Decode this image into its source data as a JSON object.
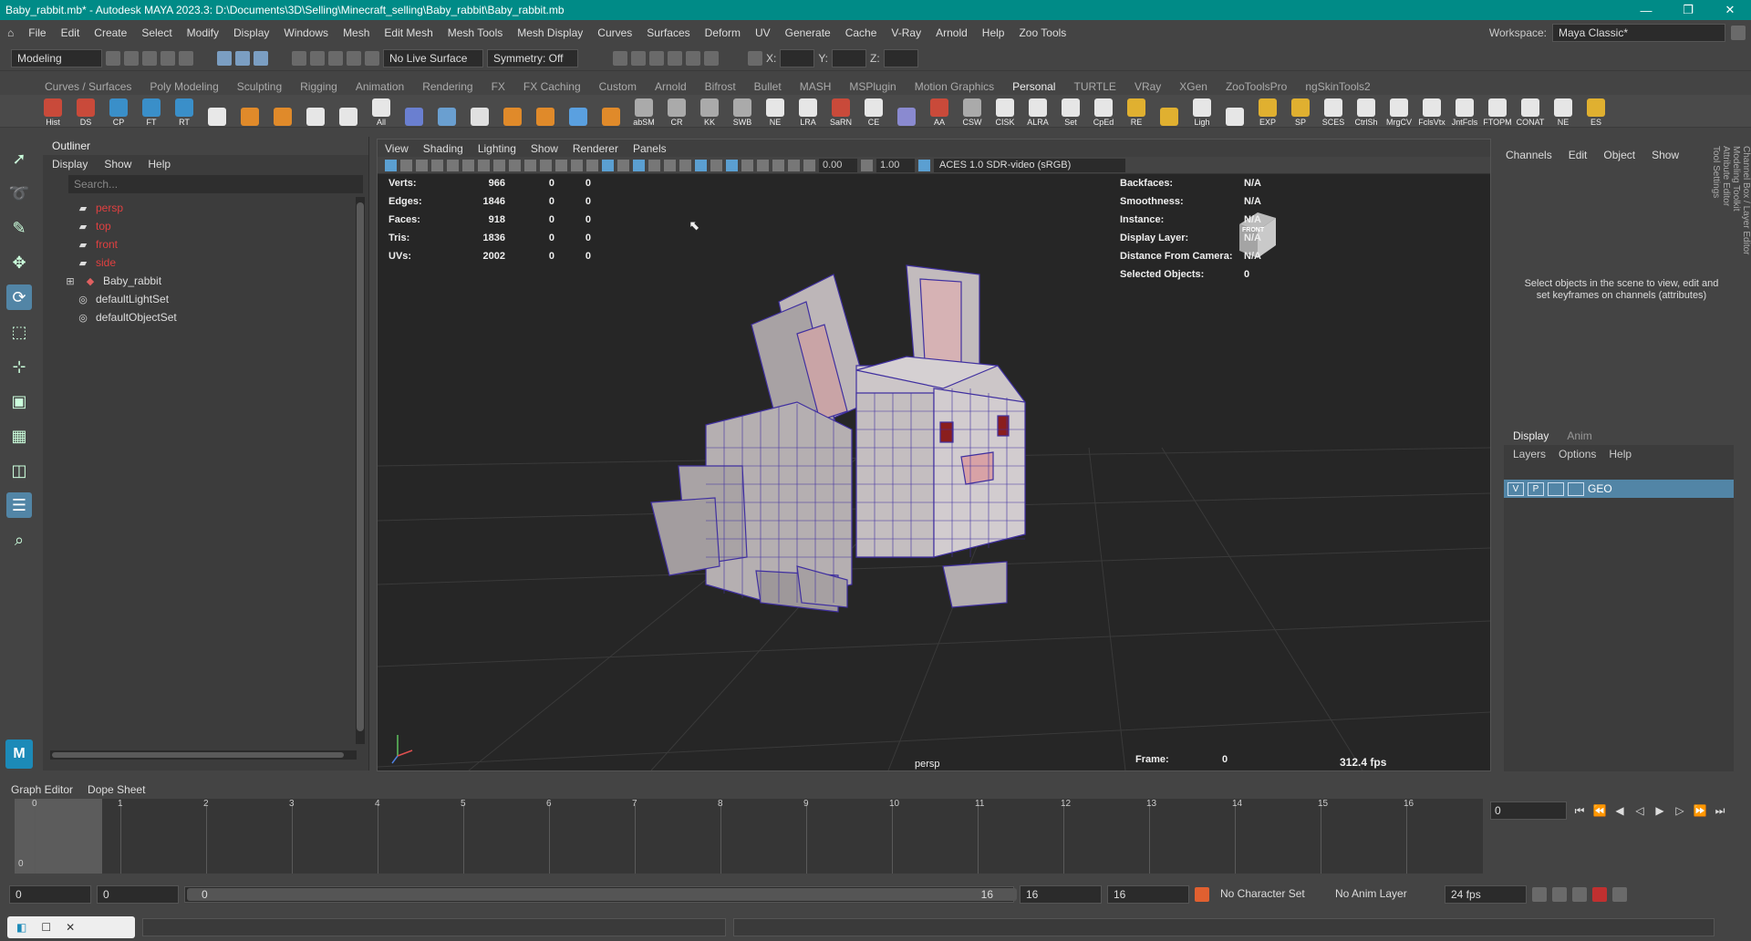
{
  "window": {
    "title": "Baby_rabbit.mb* - Autodesk MAYA 2023.3: D:\\Documents\\3D\\Selling\\Minecraft_selling\\Baby_rabbit\\Baby_rabbit.mb",
    "minimize": "—",
    "maximize": "❐",
    "close": "✕"
  },
  "menu": [
    "File",
    "Edit",
    "Create",
    "Select",
    "Modify",
    "Display",
    "Windows",
    "Mesh",
    "Edit Mesh",
    "Mesh Tools",
    "Mesh Display",
    "Curves",
    "Surfaces",
    "Deform",
    "UV",
    "Generate",
    "Cache",
    "V-Ray",
    "Arnold",
    "Help",
    "Zoo Tools"
  ],
  "workspace": {
    "label": "Workspace:",
    "value": "Maya Classic*"
  },
  "status": {
    "mode": "Modeling",
    "live": "No Live Surface",
    "symmetry": "Symmetry: Off",
    "x": "X:",
    "y": "Y:",
    "z": "Z:"
  },
  "shelf_tabs": [
    "Curves / Surfaces",
    "Poly Modeling",
    "Sculpting",
    "Rigging",
    "Animation",
    "Rendering",
    "FX",
    "FX Caching",
    "Custom",
    "Arnold",
    "Bifrost",
    "Bullet",
    "MASH",
    "MSPlugin",
    "Motion Graphics",
    "Personal",
    "TURTLE",
    "VRay",
    "XGen",
    "ZooToolsPro",
    "ngSkinTools2"
  ],
  "shelf_active": "Personal",
  "shelf_buttons": [
    {
      "label": "Hist",
      "color": "#c94a3a"
    },
    {
      "label": "DS",
      "color": "#c94a3a"
    },
    {
      "label": "CP",
      "color": "#3a8fc9"
    },
    {
      "label": "FT",
      "color": "#3a8fc9"
    },
    {
      "label": "RT",
      "color": "#3a8fc9"
    },
    {
      "label": "",
      "color": "#e8e8e8"
    },
    {
      "label": "",
      "color": "#e08a2a"
    },
    {
      "label": "",
      "color": "#e08a2a"
    },
    {
      "label": "",
      "color": "#e6e6e6"
    },
    {
      "label": "",
      "color": "#e6e6e6"
    },
    {
      "label": "All",
      "color": "#e6e6e6"
    },
    {
      "label": "",
      "color": "#6a7fd0"
    },
    {
      "label": "",
      "color": "#6a9fd0"
    },
    {
      "label": "",
      "color": "#e0e0e0"
    },
    {
      "label": "",
      "color": "#e08a2a"
    },
    {
      "label": "",
      "color": "#e08a2a"
    },
    {
      "label": "",
      "color": "#5aa0e0"
    },
    {
      "label": "",
      "color": "#e08a2a"
    },
    {
      "label": "abSM",
      "color": "#aaa"
    },
    {
      "label": "CR",
      "color": "#aaa"
    },
    {
      "label": "KK",
      "color": "#aaa"
    },
    {
      "label": "SWB",
      "color": "#aaa"
    },
    {
      "label": "NE",
      "color": "#e6e6e6"
    },
    {
      "label": "LRA",
      "color": "#e6e6e6"
    },
    {
      "label": "SaRN",
      "color": "#c94a3a"
    },
    {
      "label": "CE",
      "color": "#e6e6e6"
    },
    {
      "label": "",
      "color": "#8a8ad0"
    },
    {
      "label": "AA",
      "color": "#c94a3a"
    },
    {
      "label": "CSW",
      "color": "#aaa"
    },
    {
      "label": "CISK",
      "color": "#e6e6e6"
    },
    {
      "label": "ALRA",
      "color": "#e6e6e6"
    },
    {
      "label": "Set",
      "color": "#e6e6e6"
    },
    {
      "label": "CpEd",
      "color": "#e6e6e6"
    },
    {
      "label": "RE",
      "color": "#e0b030"
    },
    {
      "label": "",
      "color": "#e0b030"
    },
    {
      "label": "Ligh",
      "color": "#e6e6e6"
    },
    {
      "label": "",
      "color": "#e6e6e6"
    },
    {
      "label": "EXP",
      "color": "#e0b030"
    },
    {
      "label": "SP",
      "color": "#e0b030"
    },
    {
      "label": "SCES",
      "color": "#e6e6e6"
    },
    {
      "label": "CtrlSh",
      "color": "#e6e6e6"
    },
    {
      "label": "MrgCV",
      "color": "#e6e6e6"
    },
    {
      "label": "FclsVtx",
      "color": "#e6e6e6"
    },
    {
      "label": "JntFcls",
      "color": "#e6e6e6"
    },
    {
      "label": "FTOPM",
      "color": "#e6e6e6"
    },
    {
      "label": "CONAT",
      "color": "#e6e6e6"
    },
    {
      "label": "NE",
      "color": "#e6e6e6"
    },
    {
      "label": "ES",
      "color": "#e0b030"
    }
  ],
  "outliner": {
    "title": "Outliner",
    "menu": [
      "Display",
      "Show",
      "Help"
    ],
    "search_placeholder": "Search...",
    "items": [
      {
        "name": "persp",
        "kind": "camera"
      },
      {
        "name": "top",
        "kind": "camera"
      },
      {
        "name": "front",
        "kind": "camera"
      },
      {
        "name": "side",
        "kind": "camera"
      },
      {
        "name": "Baby_rabbit",
        "kind": "mesh"
      },
      {
        "name": "defaultLightSet",
        "kind": "set"
      },
      {
        "name": "defaultObjectSet",
        "kind": "set"
      }
    ]
  },
  "viewport": {
    "menu": [
      "View",
      "Shading",
      "Lighting",
      "Show",
      "Renderer",
      "Panels"
    ],
    "exposure": "0.00",
    "gamma": "1.00",
    "colorspace": "ACES 1.0 SDR-video (sRGB)",
    "camera": "persp",
    "fps": "312.4 fps",
    "hud_left": [
      [
        "Verts:",
        "966",
        "0",
        "0"
      ],
      [
        "Edges:",
        "1846",
        "0",
        "0"
      ],
      [
        "Faces:",
        "918",
        "0",
        "0"
      ],
      [
        "Tris:",
        "1836",
        "0",
        "0"
      ],
      [
        "UVs:",
        "2002",
        "0",
        "0"
      ]
    ],
    "hud_right": [
      [
        "Backfaces:",
        "N/A"
      ],
      [
        "Smoothness:",
        "N/A"
      ],
      [
        "Instance:",
        "N/A"
      ],
      [
        "Display Layer:",
        "N/A"
      ],
      [
        "Distance From Camera:",
        "N/A"
      ],
      [
        "Selected Objects:",
        "0"
      ]
    ],
    "frame_label": "Frame:",
    "frame_value": "0",
    "viewcube": "FRONT"
  },
  "channelbox": {
    "tabs": [
      "Channels",
      "Edit",
      "Object",
      "Show"
    ],
    "message": "Select objects in the scene to view, edit and set keyframes on channels (attributes)"
  },
  "layers": {
    "tabs": [
      "Display",
      "Anim"
    ],
    "menu": [
      "Layers",
      "Options",
      "Help"
    ],
    "row": {
      "v": "V",
      "p": "P",
      "name": "GEO"
    }
  },
  "side_tabs": [
    "Channel Box / Layer Editor",
    "Modeling Toolkit",
    "Attribute Editor",
    "Tool Settings"
  ],
  "bottom_tabs": [
    "Graph Editor",
    "Dope Sheet"
  ],
  "timeline": {
    "ticks": [
      "0",
      "1",
      "2",
      "3",
      "4",
      "5",
      "6",
      "7",
      "8",
      "9",
      "10",
      "11",
      "12",
      "13",
      "14",
      "15",
      "16"
    ],
    "current": "0",
    "current_field": "0"
  },
  "range": {
    "start": "0",
    "start2": "0",
    "slider_start": "0",
    "slider_end": "16",
    "end": "16",
    "end2": "16",
    "character": "No Character Set",
    "anim_layer": "No Anim Layer",
    "fps": "24 fps"
  }
}
